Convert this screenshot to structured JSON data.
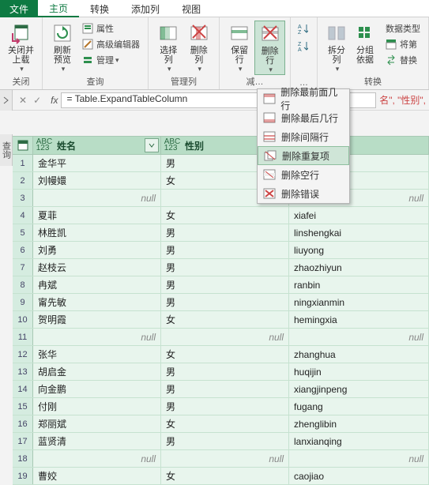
{
  "tabs": {
    "file": "文件",
    "items": [
      "主页",
      "转换",
      "添加列",
      "视图"
    ],
    "active": 0
  },
  "ribbon": {
    "close_apply": "关闭并\n上载",
    "close_apply_drop": "▾",
    "refresh": "刷新\n预览",
    "properties": "属性",
    "adv_editor": "高级编辑器",
    "manage": "管理",
    "choose_cols": "选择\n列",
    "remove_cols": "删除\n列",
    "keep_rows": "保留\n行",
    "remove_rows": "删除\n行",
    "sort_asc": "A\nZ",
    "sort_desc": "Z\nA",
    "split_col": "拆分\n列",
    "group_by": "分组\n依据",
    "data_type": "数据类型",
    "first_row_hdr": "将第",
    "replace": "替换",
    "group_labels": [
      "关闭",
      "查询",
      "管理列",
      "减…",
      "…",
      "转换"
    ]
  },
  "menu": {
    "items": [
      "删除最前面几行",
      "删除最后几行",
      "删除间隔行",
      "删除重复项",
      "删除空行",
      "删除错误"
    ],
    "hover_index": 3
  },
  "formula": {
    "text": "= Table.ExpandTableColumn",
    "tail": "名\", \"性别\","
  },
  "side_label": "查询",
  "columns": [
    {
      "name": "姓名",
      "type": "ABC123"
    },
    {
      "name": "性别",
      "type": "ABC123"
    },
    {
      "name": "",
      "type": ""
    }
  ],
  "rows": [
    {
      "n": 1,
      "c1": "金华平",
      "c2": "男",
      "c3": ""
    },
    {
      "n": 2,
      "c1": "刘幔嬛",
      "c2": "女",
      "c3": ""
    },
    {
      "n": 3,
      "c1": null,
      "c2": null,
      "c3": null
    },
    {
      "n": 4,
      "c1": "夏菲",
      "c2": "女",
      "c3": "xiafei"
    },
    {
      "n": 5,
      "c1": "林胜凯",
      "c2": "男",
      "c3": "linshengkai"
    },
    {
      "n": 6,
      "c1": "刘勇",
      "c2": "男",
      "c3": "liuyong"
    },
    {
      "n": 7,
      "c1": "赵枝云",
      "c2": "男",
      "c3": "zhaozhiyun"
    },
    {
      "n": 8,
      "c1": "冉斌",
      "c2": "男",
      "c3": "ranbin"
    },
    {
      "n": 9,
      "c1": "甯先敏",
      "c2": "男",
      "c3": "ningxianmin"
    },
    {
      "n": 10,
      "c1": "贺明霞",
      "c2": "女",
      "c3": "hemingxia"
    },
    {
      "n": 11,
      "c1": null,
      "c2": null,
      "c3": null
    },
    {
      "n": 12,
      "c1": "张华",
      "c2": "女",
      "c3": "zhanghua"
    },
    {
      "n": 13,
      "c1": "胡启金",
      "c2": "男",
      "c3": "huqijin"
    },
    {
      "n": 14,
      "c1": "向金鹏",
      "c2": "男",
      "c3": "xiangjinpeng"
    },
    {
      "n": 15,
      "c1": "付刚",
      "c2": "男",
      "c3": "fugang"
    },
    {
      "n": 16,
      "c1": "郑丽斌",
      "c2": "女",
      "c3": "zhenglibin"
    },
    {
      "n": 17,
      "c1": "蓝贤清",
      "c2": "男",
      "c3": "lanxianqing"
    },
    {
      "n": 18,
      "c1": null,
      "c2": null,
      "c3": null
    },
    {
      "n": 19,
      "c1": "曹姣",
      "c2": "女",
      "c3": "caojiao"
    }
  ],
  "null_text": "null"
}
